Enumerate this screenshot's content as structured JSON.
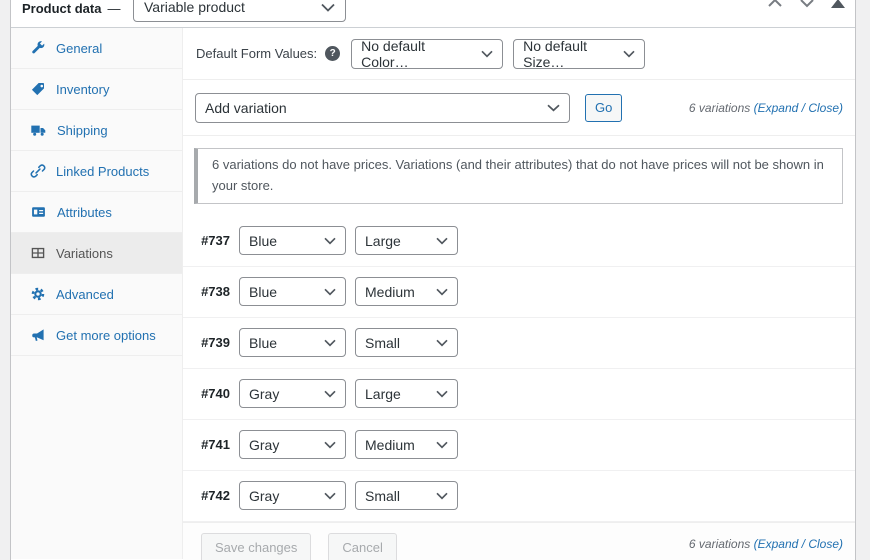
{
  "header": {
    "title": "Product data",
    "dash": "—",
    "product_type": "Variable product"
  },
  "sidebar": {
    "items": [
      {
        "label": "General",
        "icon": "wrench-icon",
        "active": false
      },
      {
        "label": "Inventory",
        "icon": "tag-icon",
        "active": false
      },
      {
        "label": "Shipping",
        "icon": "truck-icon",
        "active": false
      },
      {
        "label": "Linked Products",
        "icon": "link-icon",
        "active": false
      },
      {
        "label": "Attributes",
        "icon": "card-icon",
        "active": false
      },
      {
        "label": "Variations",
        "icon": "grid-icon",
        "active": true
      },
      {
        "label": "Advanced",
        "icon": "gear-icon",
        "active": false
      },
      {
        "label": "Get more options",
        "icon": "megaphone-icon",
        "active": false
      }
    ]
  },
  "defaults_row": {
    "label": "Default Form Values:",
    "help_glyph": "?",
    "color_select_value": "No default Color…",
    "size_select_value": "No default Size…"
  },
  "top_toolbar": {
    "add_variation_value": "Add variation",
    "go_label": "Go",
    "summary_prefix": "6 variations ",
    "paren_open": "(",
    "expand_label": "Expand",
    "separator": " / ",
    "close_label": "Close",
    "paren_close": ")"
  },
  "notice": {
    "text": "6 variations do not have prices. Variations (and their attributes) that do not have prices will not be shown in your store."
  },
  "variations": [
    {
      "id": "#737",
      "color": "Blue",
      "size": "Large"
    },
    {
      "id": "#738",
      "color": "Blue",
      "size": "Medium"
    },
    {
      "id": "#739",
      "color": "Blue",
      "size": "Small"
    },
    {
      "id": "#740",
      "color": "Gray",
      "size": "Large"
    },
    {
      "id": "#741",
      "color": "Gray",
      "size": "Medium"
    },
    {
      "id": "#742",
      "color": "Gray",
      "size": "Small"
    }
  ],
  "bottom_toolbar": {
    "save_label": "Save changes",
    "cancel_label": "Cancel",
    "summary_prefix": "6 variations ",
    "paren_open": "(",
    "expand_label": "Expand",
    "separator": " / ",
    "close_label": "Close",
    "paren_close": ")"
  },
  "colors": {
    "accent_blue": "#2271b1",
    "page_bg": "#f0f0f1",
    "active_tab_bg": "#ececec",
    "input_border": "#8c8f94",
    "muted_text": "#646970",
    "notice_left_border": "#a7aaad"
  }
}
